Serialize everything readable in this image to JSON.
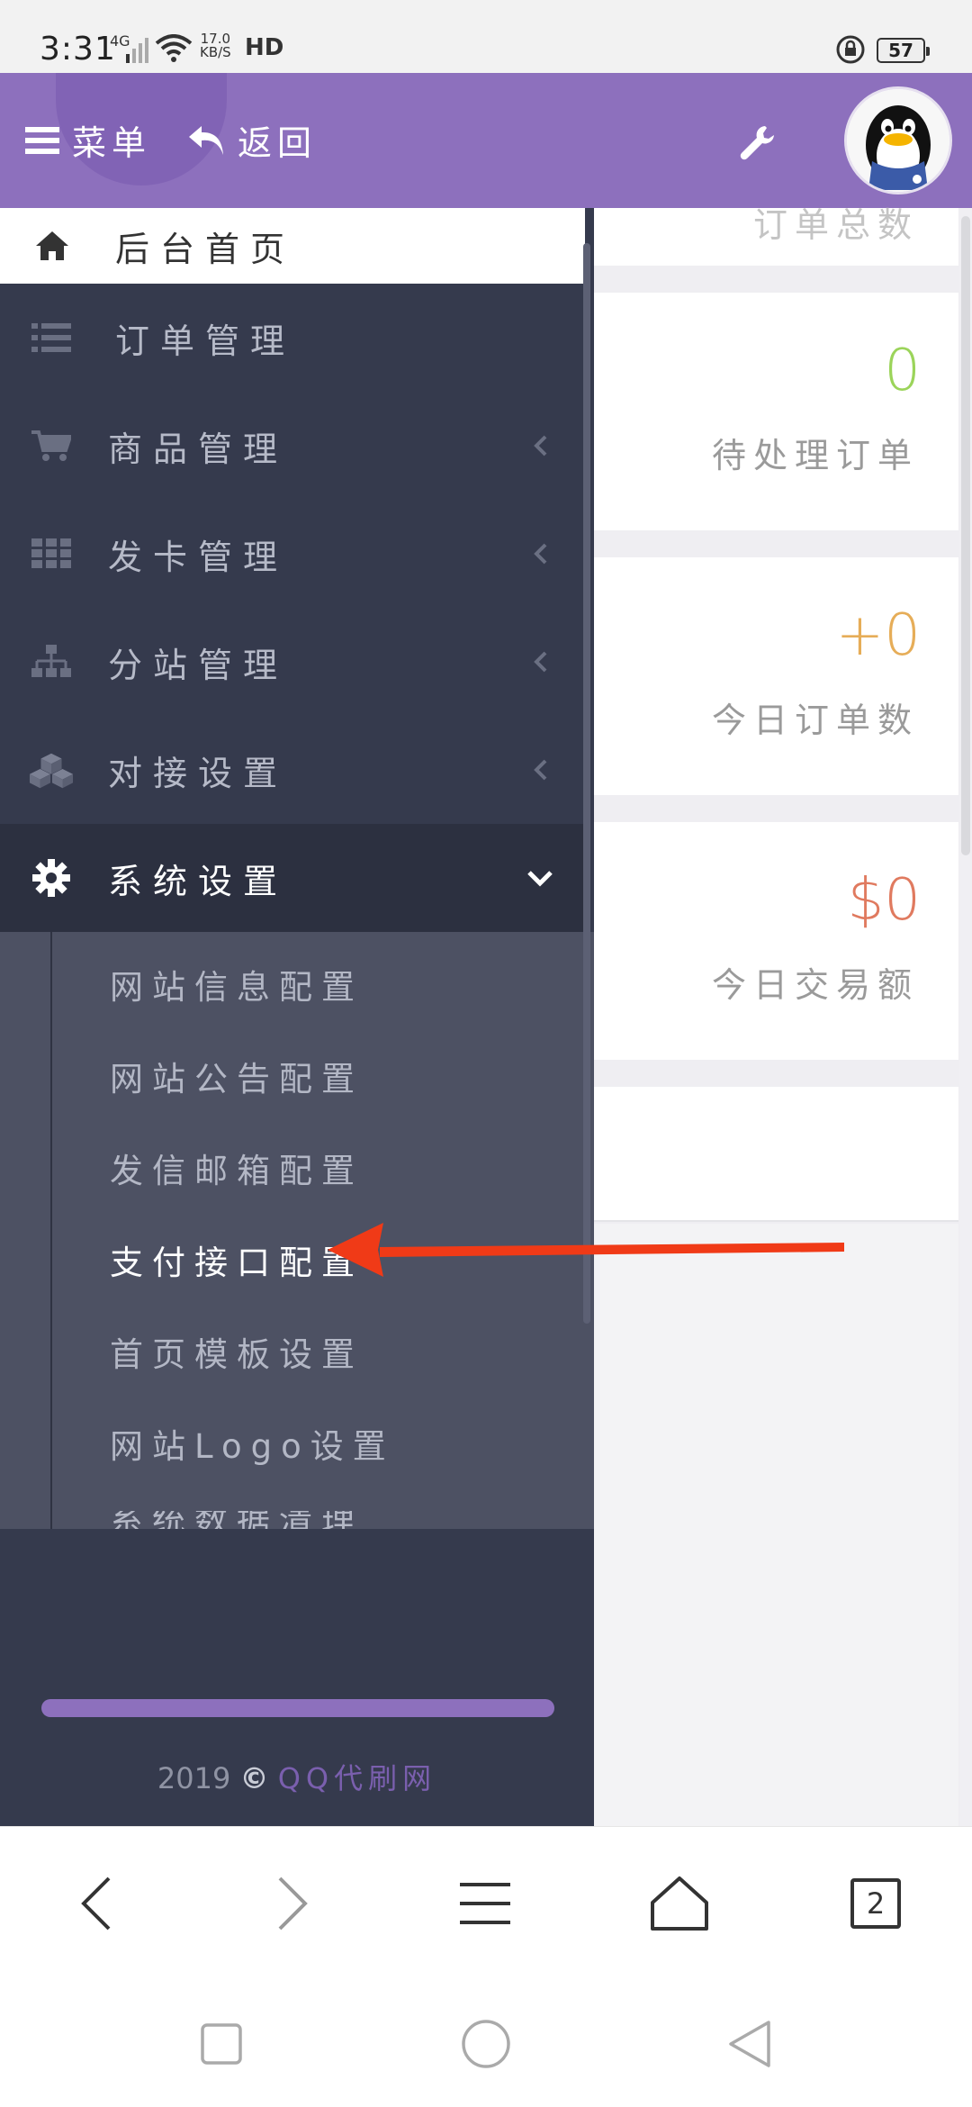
{
  "status_bar": {
    "time": "3:31",
    "network": "4G",
    "speed_value": "17.0",
    "speed_unit": "KB/S",
    "hd": "HD",
    "battery": "57"
  },
  "header": {
    "menu_label": "菜单",
    "back_label": "返回"
  },
  "sidebar": {
    "home_label": "后台首页",
    "items": [
      {
        "label": "订单管理",
        "icon": "list-icon"
      },
      {
        "label": "商品管理",
        "icon": "cart-icon"
      },
      {
        "label": "发卡管理",
        "icon": "grid-icon"
      },
      {
        "label": "分站管理",
        "icon": "sitemap-icon"
      },
      {
        "label": "对接设置",
        "icon": "cubes-icon"
      },
      {
        "label": "系统设置",
        "icon": "gear-icon"
      }
    ],
    "sub_items": [
      "网站信息配置",
      "网站公告配置",
      "发信邮箱配置",
      "支付接口配置",
      "首页模板设置",
      "网站Logo设置",
      "系统数据清理"
    ],
    "footer": {
      "year": "2019",
      "copyright_symbol": "©",
      "brand": "QQ代刷网"
    }
  },
  "content": {
    "top_label": "订单总数",
    "cards": [
      {
        "value": "0",
        "label": "待处理订单",
        "color": "#9bd45a"
      },
      {
        "value": "+0",
        "label": "今日订单数",
        "color": "#e6ad58"
      },
      {
        "value": "$0",
        "label": "今日交易额",
        "color": "#e07a5f"
      }
    ]
  },
  "browser_bar": {
    "tab_count": "2"
  },
  "colors": {
    "header": "#8d70bd",
    "sidebar": "#353a4d",
    "annotation_arrow": "#f03a17"
  }
}
